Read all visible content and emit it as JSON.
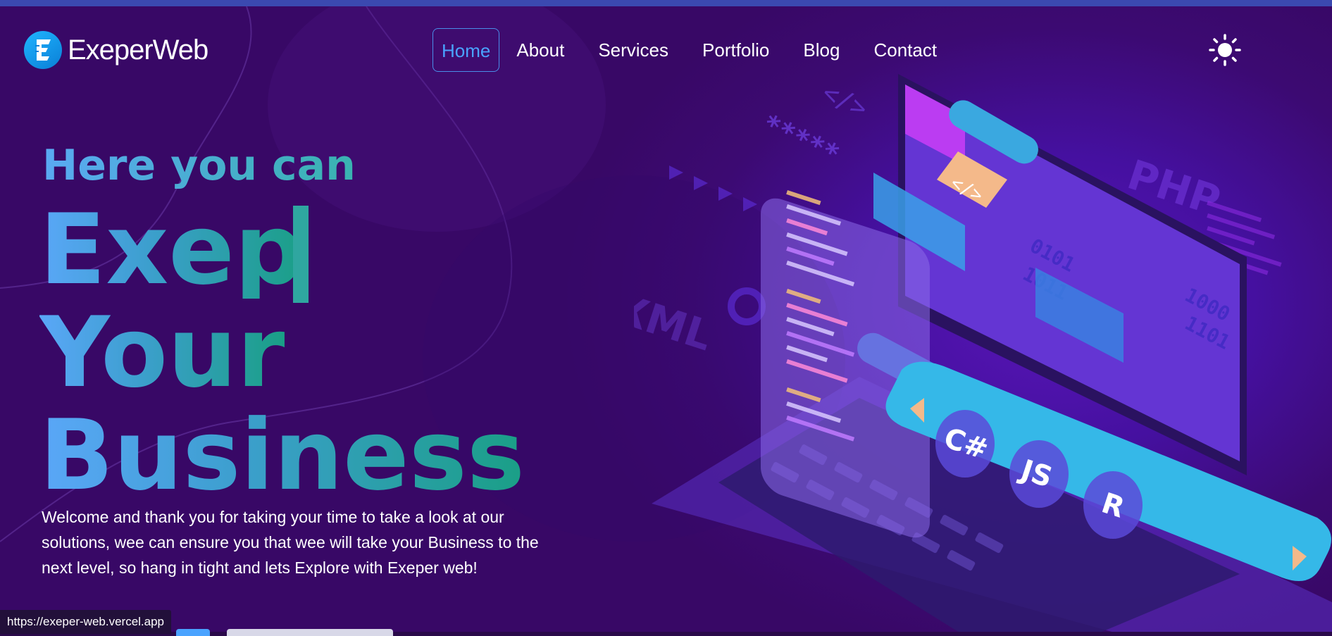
{
  "brand": {
    "name": "ExeperWeb"
  },
  "nav": {
    "items": [
      {
        "label": "Home",
        "active": true
      },
      {
        "label": "About"
      },
      {
        "label": "Services"
      },
      {
        "label": "Portfolio"
      },
      {
        "label": "Blog"
      },
      {
        "label": "Contact"
      }
    ]
  },
  "theme_toggle": {
    "icon": "sun-icon"
  },
  "hero": {
    "kicker": "Here you can",
    "line1": "Exep",
    "line2": "Your",
    "line3": "Business",
    "description": "Welcome and thank you for taking your time to take a look at our solutions, wee can ensure you that wee will take your Business to the next level, so hang in tight and lets Explore with Exeper web!"
  },
  "illustration": {
    "labels": [
      "PHP",
      "XML",
      "*****",
      "C#",
      "JS",
      "R"
    ]
  },
  "status_bar": {
    "url": "https://exeper-web.vercel.app"
  },
  "colors": {
    "background": "#3e0a6b",
    "accent": "#4aa3ff",
    "gradient_start": "#5aa7f8",
    "gradient_end": "#1a9f86"
  }
}
